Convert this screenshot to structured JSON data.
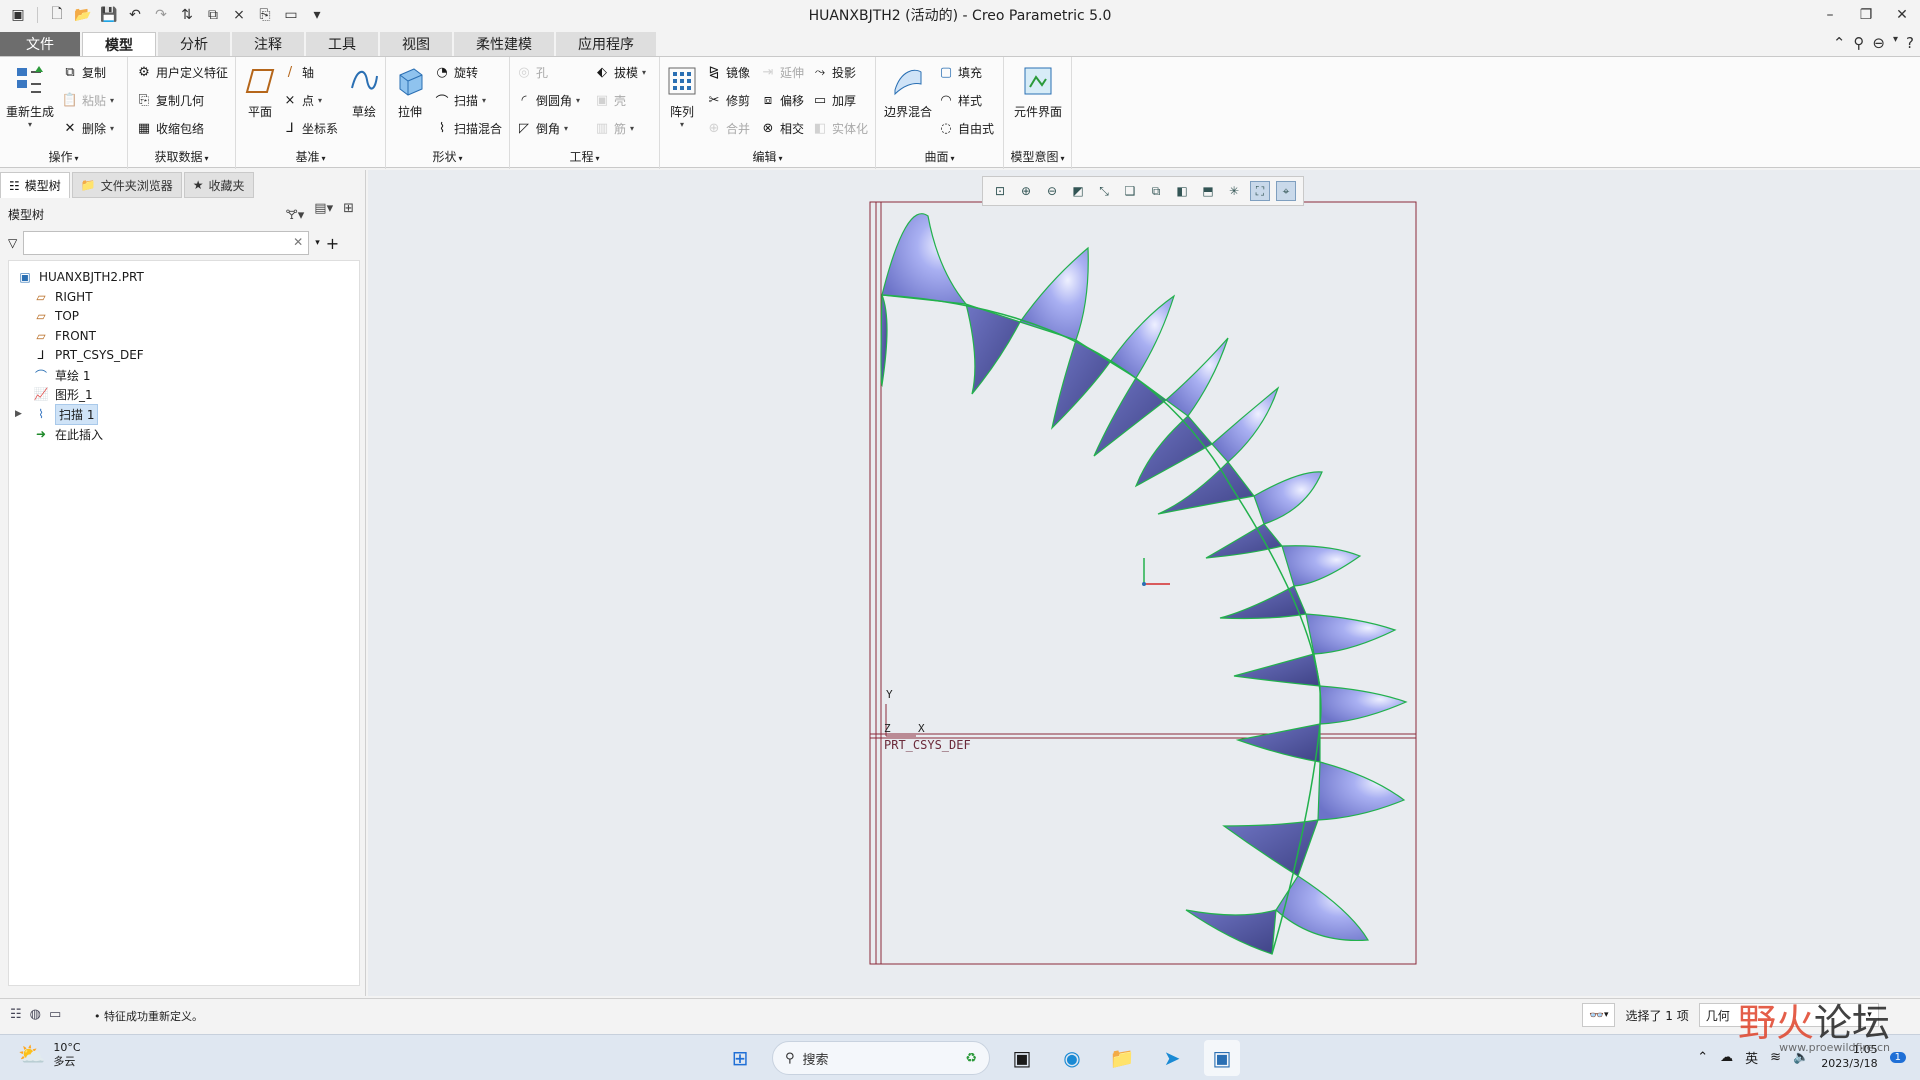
{
  "titlebar": {
    "title": "HUANXBJTH2 (活动的) - Creo Parametric 5.0",
    "quick_icons": [
      "app-icon",
      "new-icon",
      "open-icon",
      "save-icon",
      "undo-icon",
      "redo-icon",
      "regenerate-icon",
      "window-icon",
      "close-window-icon",
      "save-copy-icon",
      "screen-icon",
      "customize-icon"
    ]
  },
  "tabs": [
    "文件",
    "模型",
    "分析",
    "注释",
    "工具",
    "视图",
    "柔性建模",
    "应用程序"
  ],
  "active_tab": "模型",
  "ribbon": {
    "ops": {
      "label": "操作",
      "regen": "重新生成",
      "copy": "复制",
      "paste": "粘贴",
      "delete": "删除"
    },
    "getdata": {
      "label": "获取数据",
      "udf": "用户定义特征",
      "copygeom": "复制几何",
      "shrinkwrap": "收缩包络"
    },
    "datum": {
      "label": "基准",
      "plane": "平面",
      "axis": "轴",
      "point": "点",
      "csys": "坐标系",
      "sketch": "草绘"
    },
    "shapes": {
      "label": "形状",
      "extrude": "拉伸",
      "revolve": "旋转",
      "sweep": "扫描",
      "sweepblend": "扫描混合"
    },
    "eng": {
      "label": "工程",
      "hole": "孔",
      "round": "倒圆角",
      "chamfer": "倒角",
      "draft": "拔模",
      "shell": "壳",
      "rib": "筋"
    },
    "edit": {
      "label": "编辑",
      "pattern": "阵列",
      "mirror": "镜像",
      "trim": "修剪",
      "merge": "合并",
      "extend": "延伸",
      "offset": "偏移",
      "intersect": "相交",
      "project": "投影",
      "thicken": "加厚",
      "solidify": "实体化"
    },
    "surf": {
      "label": "曲面",
      "boundary": "边界混合",
      "fill": "填充",
      "style": "样式",
      "freestyle": "自由式"
    },
    "intent": {
      "label": "模型意图",
      "compint": "元件界面"
    }
  },
  "panel": {
    "tabs": [
      "模型树",
      "文件夹浏览器",
      "收藏夹"
    ],
    "toolbar_title": "模型树",
    "search_placeholder": "",
    "tree": [
      {
        "label": "HUANXBJTH2.PRT",
        "icon": "part-icon"
      },
      {
        "label": "RIGHT",
        "icon": "datum-plane-icon"
      },
      {
        "label": "TOP",
        "icon": "datum-plane-icon"
      },
      {
        "label": "FRONT",
        "icon": "datum-plane-icon"
      },
      {
        "label": "PRT_CSYS_DEF",
        "icon": "csys-icon"
      },
      {
        "label": "草绘 1",
        "icon": "sketch-icon"
      },
      {
        "label": "图形_1",
        "icon": "graph-icon"
      },
      {
        "label": "扫描 1",
        "icon": "sweep-icon",
        "selected": true
      },
      {
        "label": "在此插入",
        "icon": "insert-arrow-icon"
      }
    ]
  },
  "graphics": {
    "csys_label": "PRT_CSYS_DEF",
    "axis_y": "Y",
    "axis_z": "Z",
    "axis_x": "X",
    "colors": {
      "surface_light": "#a8b0f0",
      "surface_dark": "#4d5296",
      "edge": "#22b14c",
      "datum": "#8a2a3a"
    }
  },
  "status": {
    "message": "• 特征成功重新定义。",
    "selection": "选择了 1 项",
    "filter": "几何"
  },
  "taskbar": {
    "temp": "10°C",
    "weather": "多云",
    "search": "搜索",
    "lang": "英",
    "time": "1:05",
    "date": "2023/3/18"
  },
  "watermark": {
    "text1": "野火",
    "text2": "论坛",
    "url": "www.proewildfire.cn"
  }
}
